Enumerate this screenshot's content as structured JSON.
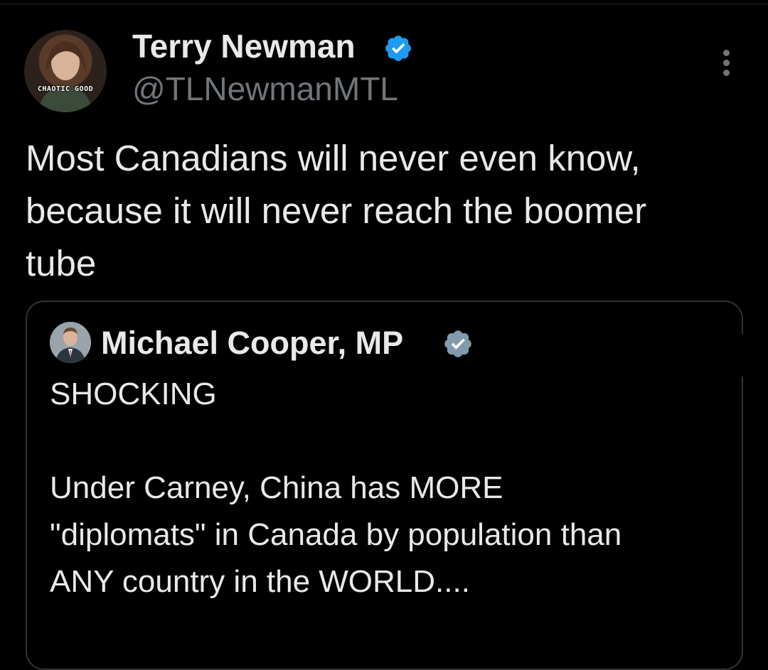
{
  "tweet": {
    "author": {
      "display_name": "Terry Newman",
      "handle": "@TLNewmanMTL",
      "verified": true,
      "avatar_caption": "CHAOTIC GOOD"
    },
    "more_icon": "more-vertical-icon",
    "text": "Most Canadians will never even know,\nbecause it will never reach the boomer\ntube"
  },
  "quoted_tweet": {
    "author": {
      "display_name": "Michael Cooper, MP",
      "verified": true
    },
    "text": "SHOCKING\n\nUnder Carney, China has MORE\n\"diplomats\" in Canada by population than\nANY country in the WORLD...."
  },
  "colors": {
    "background": "#000000",
    "primary_text": "#e7e9ea",
    "secondary_text": "#71767b",
    "verified_blue": "#1d9bf0",
    "verified_gray": "#829aab",
    "card_border": "#2f3336"
  }
}
